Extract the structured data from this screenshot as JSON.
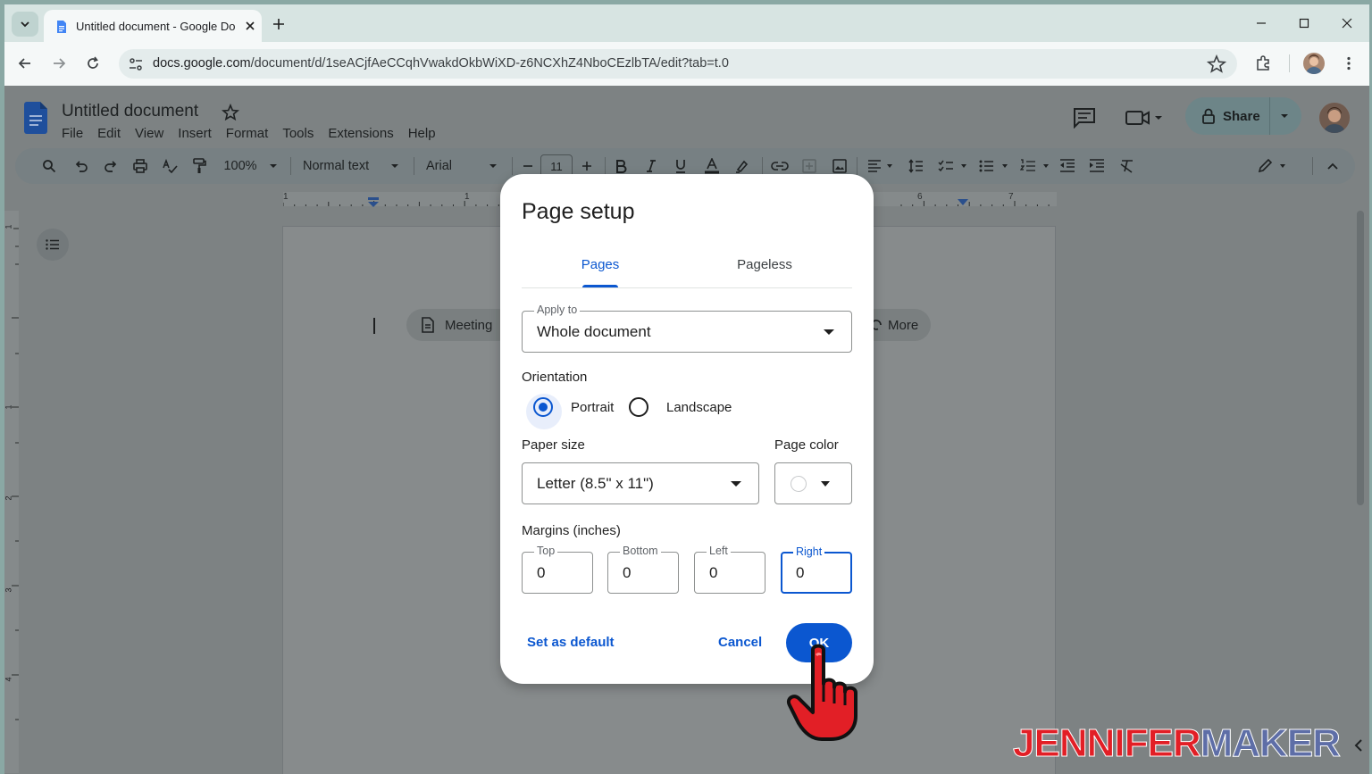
{
  "browser": {
    "tab_title": "Untitled document - Google Do",
    "url_host": "docs.google.com",
    "url_path": "/document/d/1seACjfAeCCqhVwakdOkbWiXD-z6NCXhZ4NboCEzlbTA/edit?tab=t.0"
  },
  "docs": {
    "title": "Untitled document",
    "menu": [
      "File",
      "Edit",
      "View",
      "Insert",
      "Format",
      "Tools",
      "Extensions",
      "Help"
    ],
    "share_label": "Share",
    "toolbar": {
      "zoom": "100%",
      "style": "Normal text",
      "font": "Arial",
      "font_size": "11"
    },
    "ruler_numbers": [
      "1",
      "1",
      "6",
      "7"
    ],
    "vruler_numbers": [
      "1",
      "1",
      "2",
      "3",
      "4"
    ],
    "chips": {
      "meeting": "Meeting",
      "more": "More"
    }
  },
  "dialog": {
    "title": "Page setup",
    "tabs": {
      "pages": "Pages",
      "pageless": "Pageless",
      "selected": "Pages"
    },
    "apply_to": {
      "label": "Apply to",
      "value": "Whole document"
    },
    "orientation": {
      "label": "Orientation",
      "portrait": "Portrait",
      "landscape": "Landscape",
      "selected": "Portrait"
    },
    "paper_size": {
      "label": "Paper size",
      "value": "Letter (8.5\" x 11\")"
    },
    "page_color": {
      "label": "Page color",
      "value": "#ffffff"
    },
    "margins": {
      "label": "Margins (inches)",
      "top": {
        "label": "Top",
        "value": "0"
      },
      "bottom": {
        "label": "Bottom",
        "value": "0"
      },
      "left": {
        "label": "Left",
        "value": "0"
      },
      "right": {
        "label": "Right",
        "value": "0"
      }
    },
    "set_default": "Set as default",
    "cancel": "Cancel",
    "ok": "OK"
  },
  "watermark": {
    "part1": "JENNIFER",
    "part2": "MAKER"
  },
  "colors": {
    "accent": "#0b57d0",
    "cursor_hand": "#e21f26"
  }
}
